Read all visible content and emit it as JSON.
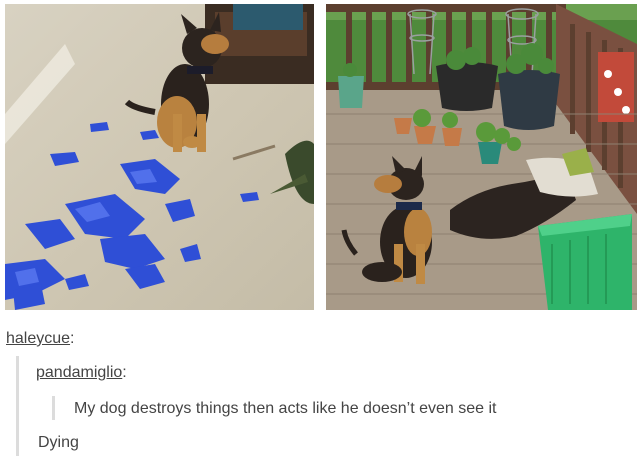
{
  "post": {
    "original_poster": "haleycue",
    "reblogger": "pandamiglio",
    "separator": ":",
    "quote": "My dog destroys things then acts like he doesn’t even see it",
    "reply": "Dying"
  },
  "photos": {
    "left_description_icon": "dog-with-shredded-blue-item-photo",
    "right_description_icon": "dog-with-knocked-over-potting-soil-photo"
  },
  "colors": {
    "text": "#444444",
    "quote_bar": "#dcdcdc",
    "blue_shreds": "#2f4fd6",
    "deck_wood": "#a89a88",
    "green_bin": "#2eb46a"
  }
}
